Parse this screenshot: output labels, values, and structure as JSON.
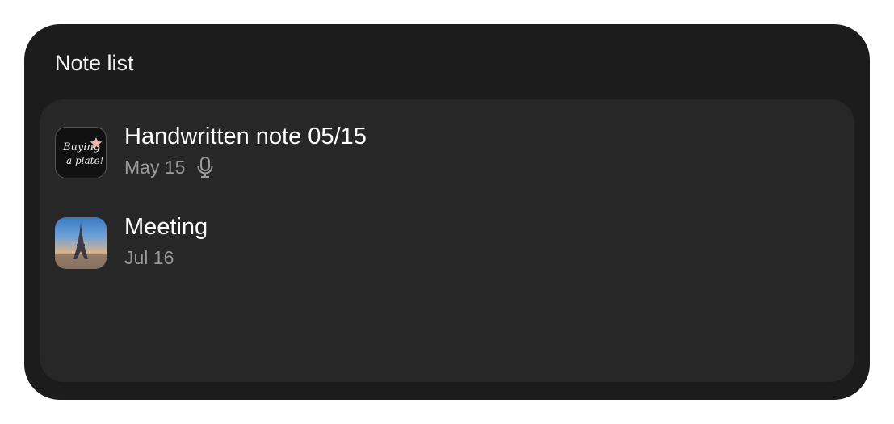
{
  "widget": {
    "title": "Note list"
  },
  "notes": [
    {
      "title": "Handwritten note 05/15",
      "date": "May 15",
      "thumbnail_icon": "handwritten-note-thumbnail",
      "thumbnail_text": "Buying a plate!",
      "has_audio": true,
      "audio_icon": "microphone-icon"
    },
    {
      "title": "Meeting",
      "date": "Jul 16",
      "thumbnail_icon": "eiffel-tower-photo-thumbnail",
      "has_audio": false
    }
  ],
  "colors": {
    "widget_bg": "#1c1c1c",
    "panel_bg": "#272727",
    "title_text": "#ffffff",
    "secondary_text": "#9a9a9a"
  }
}
